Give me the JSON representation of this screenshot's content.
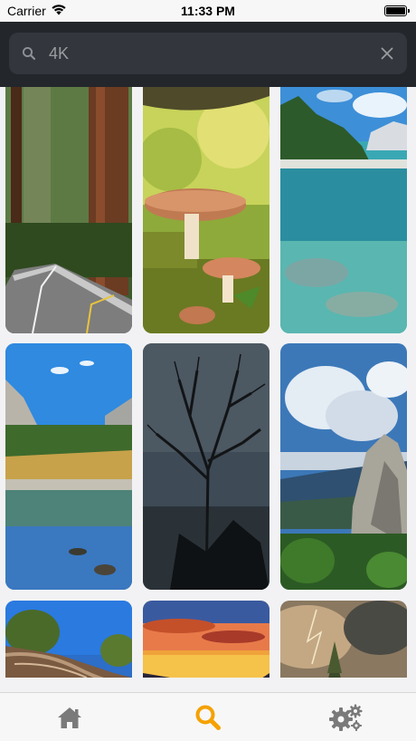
{
  "status_bar": {
    "carrier": "Carrier",
    "time": "11:33 PM",
    "icons": [
      "wifi-icon",
      "battery-icon"
    ]
  },
  "search": {
    "value": "4K",
    "icons": [
      "search-icon",
      "clear-icon"
    ]
  },
  "gallery": {
    "tiles": [
      "redwood-forest-road",
      "mushrooms-in-forest",
      "turquoise-mountain-lake",
      "yosemite-river-reflection",
      "bare-tree-silhouette",
      "rocky-peak-clouds",
      "fallen-tree-blue-sky",
      "sunset-clouds",
      "stormy-sky-tree"
    ]
  },
  "tab_bar": {
    "tabs": [
      {
        "icon": "home-icon",
        "active": false
      },
      {
        "icon": "search-icon",
        "active": true
      },
      {
        "icon": "settings-icon",
        "active": false
      }
    ],
    "active_color": "#f5a100",
    "inactive_color": "#7a7a7a"
  },
  "colors": {
    "header_bg": "#23262b",
    "search_field_bg": "#33373d",
    "accent": "#f5a100"
  }
}
